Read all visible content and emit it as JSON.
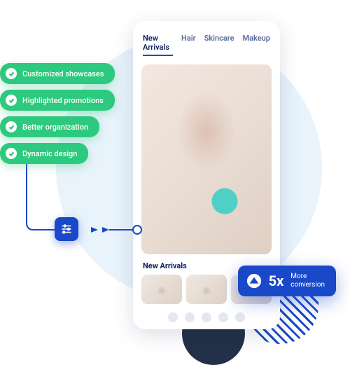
{
  "tabs": [
    "New Arrivals",
    "Hair",
    "Skincare",
    "Makeup"
  ],
  "active_tab": "New Arrivals",
  "section_title": "New Arrivals",
  "features": [
    "Customized showcases",
    "Highlighted promotions",
    "Better organization",
    "Dynamic design"
  ],
  "stat": {
    "value": "5x",
    "label_line1": "More",
    "label_line2": "conversion"
  },
  "colors": {
    "accent": "#1948c9",
    "success": "#2dc97e",
    "ink": "#0f1f5f"
  }
}
